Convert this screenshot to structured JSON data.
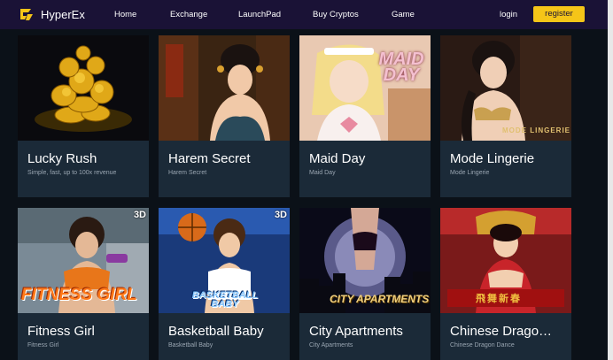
{
  "brand": {
    "name": "HyperEx"
  },
  "nav": {
    "links": [
      "Home",
      "Exchange",
      "LaunchPad",
      "Buy Cryptos",
      "Game"
    ],
    "login": "login",
    "register": "register"
  },
  "games": [
    {
      "title": "Lucky Rush",
      "subtitle": "Simple, fast, up to 100x revenue",
      "art_text": ""
    },
    {
      "title": "Harem Secret",
      "subtitle": "Harem Secret",
      "art_text": ""
    },
    {
      "title": "Maid Day",
      "subtitle": "Maid Day",
      "art_text": "MAID DAY"
    },
    {
      "title": "Mode Lingerie",
      "subtitle": "Mode Lingerie",
      "art_text": "MODE LINGERIE"
    },
    {
      "title": "Fitness Girl",
      "subtitle": "Fitness Girl",
      "art_text": "FITNESS GIRL",
      "badge": "3D"
    },
    {
      "title": "Basketball Baby",
      "subtitle": "Basketball Baby",
      "art_text": "BASKETBALL BABY",
      "badge": "3D"
    },
    {
      "title": "City Apartments",
      "subtitle": "City Apartments",
      "art_text": "CITY APARTMENTS"
    },
    {
      "title": "Chinese Drago…",
      "subtitle": "Chinese Dragon Dance",
      "art_text": "飛舞新春"
    }
  ],
  "colors": {
    "nav_bg": "#1a1236",
    "page_bg": "#0b1118",
    "card_bg": "#1b2a38",
    "accent": "#f5c518"
  }
}
